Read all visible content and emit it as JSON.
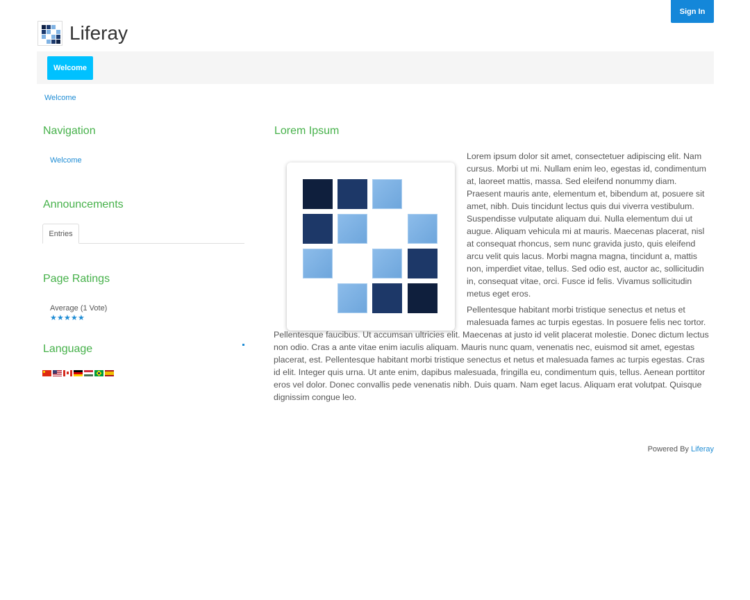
{
  "header": {
    "sign_in_label": "Sign In",
    "site_name": "Liferay",
    "logo_icon": "liferay-logo-icon"
  },
  "navbar": {
    "items": [
      {
        "label": "Welcome",
        "active": true
      }
    ]
  },
  "breadcrumb": {
    "items": [
      "Welcome"
    ]
  },
  "sidebar": {
    "navigation": {
      "title": "Navigation",
      "items": [
        "Welcome"
      ]
    },
    "announcements": {
      "title": "Announcements",
      "tabs": [
        "Entries"
      ]
    },
    "page_ratings": {
      "title": "Page Ratings",
      "average_label": "Average (1 Vote)",
      "stars": 5,
      "max_stars": 5
    },
    "language": {
      "title": "Language",
      "flags": [
        "china-flag-icon",
        "usa-flag-icon",
        "canada-flag-icon",
        "germany-flag-icon",
        "hungary-flag-icon",
        "brazil-flag-icon",
        "spain-flag-icon"
      ]
    }
  },
  "main": {
    "title": "Lorem Ipsum",
    "paragraph1": "Lorem ipsum dolor sit amet, consectetuer adipiscing elit. Nam cursus. Morbi ut mi. Nullam enim leo, egestas id, condimentum at, laoreet mattis, massa. Sed eleifend nonummy diam. Praesent mauris ante, elementum et, bibendum at, posuere sit amet, nibh. Duis tincidunt lectus quis dui viverra vestibulum. Suspendisse vulputate aliquam dui. Nulla elementum dui ut augue. Aliquam vehicula mi at mauris. Maecenas placerat, nisl at consequat rhoncus, sem nunc gravida justo, quis eleifend arcu velit quis lacus. Morbi magna magna, tincidunt a, mattis non, imperdiet vitae, tellus. Sed odio est, auctor ac, sollicitudin in, consequat vitae, orci. Fusce id felis. Vivamus sollicitudin metus eget eros.",
    "paragraph2": "Pellentesque habitant morbi tristique senectus et netus et malesuada fames ac turpis egestas. In posuere felis nec tortor. Pellentesque faucibus. Ut accumsan ultricies elit. Maecenas at justo id velit placerat molestie. Donec dictum lectus non odio. Cras a ante vitae enim iaculis aliquam. Mauris nunc quam, venenatis nec, euismod sit amet, egestas placerat, est. Pellentesque habitant morbi tristique senectus et netus et malesuada fames ac turpis egestas. Cras id elit. Integer quis urna. Ut ante enim, dapibus malesuada, fringilla eu, condimentum quis, tellus. Aenean porttitor eros vel dolor. Donec convallis pede venenatis nibh. Duis quam. Nam eget lacus. Aliquam erat volutpat. Quisque dignissim congue leo.",
    "image_icon": "liferay-logo-icon"
  },
  "footer": {
    "powered_by": "Powered By",
    "link": "Liferay"
  },
  "colors": {
    "accent": "#00c1ff",
    "sign_in": "#1487d9",
    "heading": "#46b14a",
    "link": "#1e8cd4"
  }
}
